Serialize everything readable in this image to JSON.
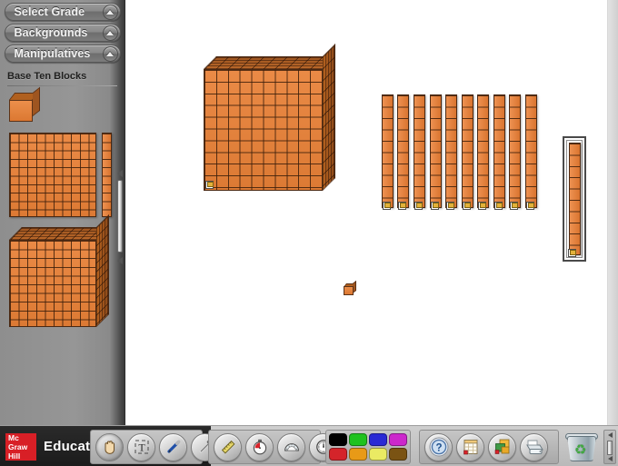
{
  "sidebar": {
    "buttons": [
      {
        "label": "Select Grade",
        "icon": "chevron-up-icon"
      },
      {
        "label": "Backgrounds",
        "icon": "chevron-up-icon"
      },
      {
        "label": "Manipulatives",
        "icon": "chevron-up-icon"
      }
    ],
    "section_title": "Base Ten Blocks",
    "tray_items": [
      {
        "name": "unit-cube",
        "value": 1
      },
      {
        "name": "flat-hundred",
        "value": 100,
        "rows": 10,
        "cols": 10
      },
      {
        "name": "rod-ten",
        "value": 10,
        "segments": 10
      },
      {
        "name": "thousand-cube",
        "value": 1000,
        "rows": 10,
        "cols": 10
      }
    ],
    "scrollbar": {
      "up": "scroll-up-arrow",
      "down": "scroll-down-arrow"
    }
  },
  "canvas": {
    "objects": [
      {
        "name": "thousand-cube",
        "value": 1000,
        "rows": 10,
        "cols": 10,
        "selected": false
      },
      {
        "name": "rod-group",
        "count": 10,
        "value": 10,
        "segments": 10,
        "selected": false
      },
      {
        "name": "rod-ten",
        "value": 10,
        "segments": 10,
        "selected": true
      },
      {
        "name": "unit-cube",
        "value": 1,
        "selected": false
      }
    ],
    "total_value": 1111
  },
  "toolbar": {
    "brand_line1": "Mc",
    "brand_line2": "Graw",
    "brand_line3": "Hill",
    "brand_name": "Education",
    "tools_left": [
      {
        "name": "hand-tool",
        "icon": "hand-icon",
        "active": true
      },
      {
        "name": "text-tool",
        "icon": "text-icon",
        "active": false
      },
      {
        "name": "pen-tool",
        "icon": "pen-icon",
        "active": false
      },
      {
        "name": "eraser-tool",
        "icon": "eraser-icon",
        "active": false
      }
    ],
    "tools_mid": [
      {
        "name": "ruler-tool",
        "icon": "ruler-icon",
        "active": false
      },
      {
        "name": "stopwatch-tool",
        "icon": "stopwatch-icon",
        "active": false
      },
      {
        "name": "protractor-tool",
        "icon": "protractor-icon",
        "active": false
      },
      {
        "name": "clock-tool",
        "icon": "clock-icon",
        "active": false
      }
    ],
    "colors": [
      {
        "name": "black",
        "hex": "#000000"
      },
      {
        "name": "green",
        "hex": "#1fc21f"
      },
      {
        "name": "blue",
        "hex": "#2a2ad4"
      },
      {
        "name": "magenta",
        "hex": "#cc27cc"
      },
      {
        "name": "red",
        "hex": "#d4242a"
      },
      {
        "name": "orange",
        "hex": "#e89a17"
      },
      {
        "name": "yellow",
        "hex": "#eaea63"
      },
      {
        "name": "brown",
        "hex": "#7a5313"
      }
    ],
    "tools_right": [
      {
        "name": "help-button",
        "icon": "question-mark-icon"
      },
      {
        "name": "new-page-button",
        "icon": "page-icon"
      },
      {
        "name": "open-file-button",
        "icon": "folders-icon"
      },
      {
        "name": "print-button",
        "icon": "printer-icon"
      }
    ],
    "trash": {
      "name": "trash-can",
      "icon": "recycle-icon"
    },
    "scrollbar": {
      "up": "scroll-up-arrow",
      "down": "scroll-down-arrow"
    }
  }
}
